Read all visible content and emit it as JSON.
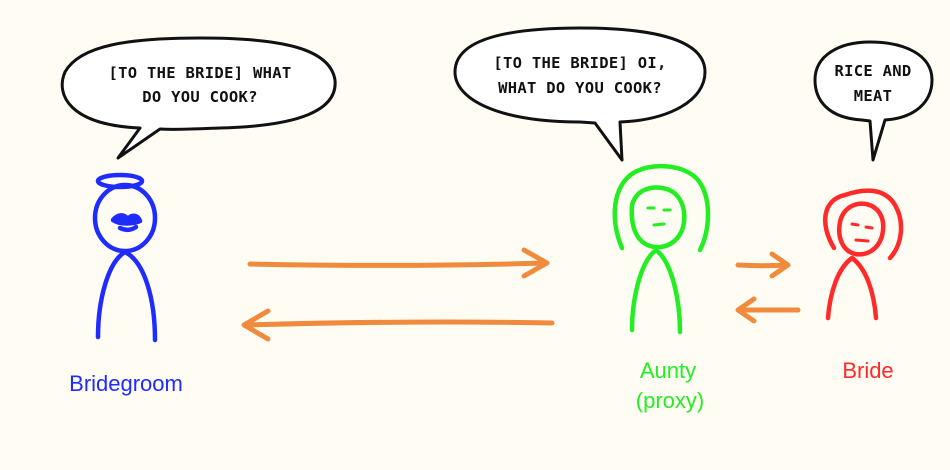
{
  "colors": {
    "background": "#fffdf3",
    "bridegroom": "#1f2cff",
    "aunty": "#22ee22",
    "bride": "#ff2a2a",
    "arrow": "#f08a3c",
    "bubble_stroke": "#111111"
  },
  "bubbles": {
    "bridegroom": {
      "line1": "[TO THE BRIDE] WHAT",
      "line2": "DO YOU COOK?"
    },
    "aunty": {
      "line1": "[TO THE BRIDE] OI,",
      "line2": "WHAT DO YOU COOK?"
    },
    "bride": {
      "line1": "RICE AND",
      "line2": "MEAT"
    }
  },
  "labels": {
    "bridegroom": "Bridegroom",
    "aunty_line1": "Aunty",
    "aunty_line2": "(proxy)",
    "bride": "Bride"
  }
}
